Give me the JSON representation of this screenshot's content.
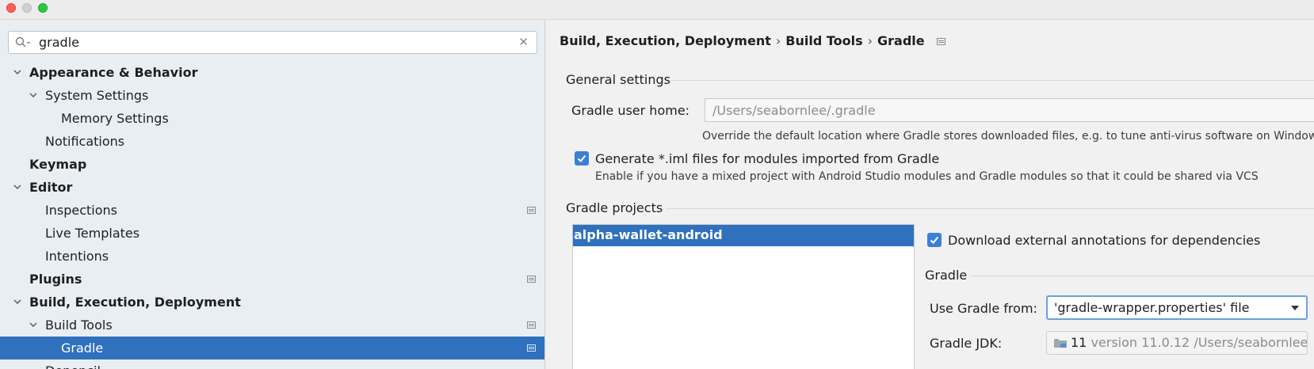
{
  "search": {
    "value": "gradle",
    "clear_glyph": "✕"
  },
  "tree": [
    {
      "label": "Appearance & Behavior",
      "bold": true,
      "expanded": true
    },
    {
      "label": "System Settings",
      "bold": false,
      "expanded": true
    },
    {
      "label": "Memory Settings",
      "bold": false
    },
    {
      "label": "Notifications",
      "bold": false
    },
    {
      "label": "Keymap",
      "bold": true
    },
    {
      "label": "Editor",
      "bold": true,
      "expanded": true
    },
    {
      "label": "Inspections",
      "bold": false
    },
    {
      "label": "Live Templates",
      "bold": false
    },
    {
      "label": "Intentions",
      "bold": false
    },
    {
      "label": "Plugins",
      "bold": true
    },
    {
      "label": "Build, Execution, Deployment",
      "bold": true,
      "expanded": true
    },
    {
      "label": "Build Tools",
      "bold": false,
      "expanded": true
    },
    {
      "label": "Gradle",
      "bold": false,
      "selected": true
    },
    {
      "label": "Depencil...",
      "bold": false
    }
  ],
  "breadcrumb": {
    "part1": "Build, Execution, Deployment",
    "sep": "›",
    "part2": "Build Tools",
    "part3": "Gradle"
  },
  "general": {
    "title": "General settings",
    "home_label": "Gradle user home:",
    "home_value": "/Users/seabornlee/.gradle",
    "home_hint": "Override the default location where Gradle stores downloaded files, e.g. to tune anti-virus software on Windows",
    "iml_label": "Generate *.iml files for modules imported from Gradle",
    "iml_hint": "Enable if you have a mixed project with Android Studio modules and Gradle modules so that it could be shared via VCS",
    "iml_checked": true
  },
  "projects": {
    "title": "Gradle projects",
    "items": [
      "alpha-wallet-android"
    ],
    "download_label": "Download external annotations for dependencies",
    "download_checked": true
  },
  "gradle": {
    "title": "Gradle",
    "use_from_label": "Use Gradle from:",
    "use_from_value": "'gradle-wrapper.properties' file",
    "jdk_label": "Gradle JDK:",
    "jdk_name": "11",
    "jdk_version": "version 11.0.12",
    "jdk_path": "/Users/seabornlee"
  },
  "colors": {
    "accent": "#2f71bd",
    "checkbox": "#3a80d6"
  }
}
